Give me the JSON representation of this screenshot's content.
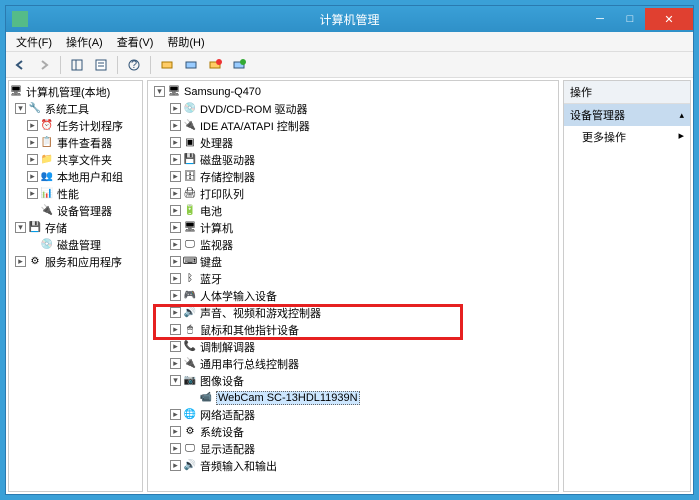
{
  "window": {
    "title": "计算机管理",
    "min": "─",
    "max": "□",
    "close": "✕"
  },
  "menu": {
    "file": "文件(F)",
    "action": "操作(A)",
    "view": "查看(V)",
    "help": "帮助(H)"
  },
  "left_tree": {
    "root": "计算机管理(本地)",
    "system_tools": "系统工具",
    "task_scheduler": "任务计划程序",
    "event_viewer": "事件查看器",
    "shared_folders": "共享文件夹",
    "local_users": "本地用户和组",
    "performance": "性能",
    "device_manager": "设备管理器",
    "storage": "存储",
    "disk_mgmt": "磁盘管理",
    "services": "服务和应用程序"
  },
  "mid_tree": {
    "root": "Samsung-Q470",
    "items": [
      "DVD/CD-ROM 驱动器",
      "IDE ATA/ATAPI 控制器",
      "处理器",
      "磁盘驱动器",
      "存储控制器",
      "打印队列",
      "电池",
      "计算机",
      "监视器",
      "键盘",
      "蓝牙",
      "人体学输入设备",
      "声音、视频和游戏控制器",
      "鼠标和其他指针设备",
      "调制解调器",
      "通用串行总线控制器"
    ],
    "imaging": "图像设备",
    "webcam": "WebCam SC-13HDL11939N",
    "items2": [
      "网络适配器",
      "系统设备",
      "显示适配器",
      "音频输入和输出"
    ]
  },
  "right": {
    "header": "操作",
    "section": "设备管理器",
    "more": "更多操作"
  }
}
